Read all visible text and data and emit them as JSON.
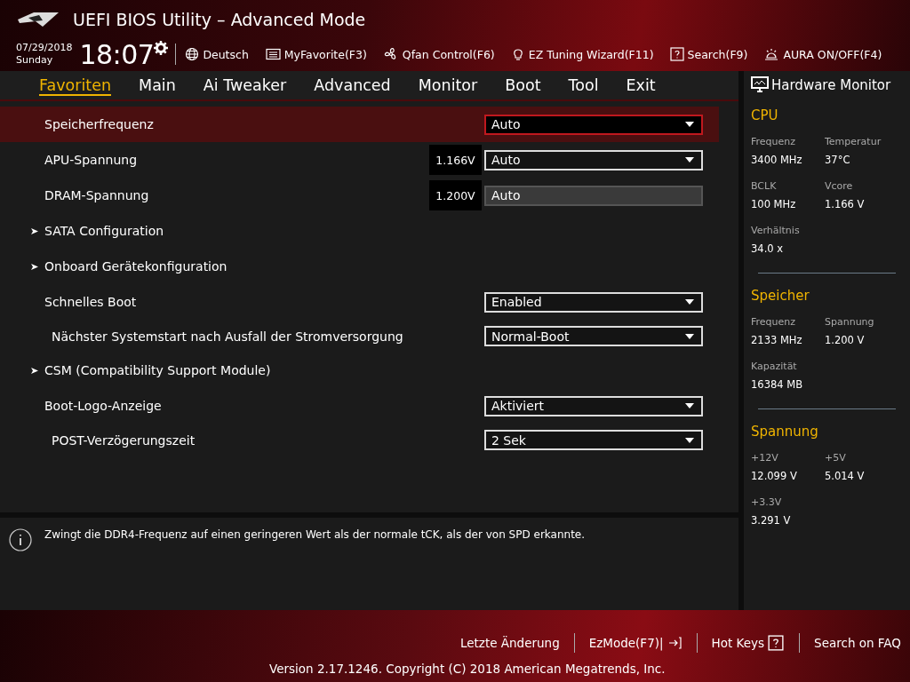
{
  "header": {
    "title": "UEFI BIOS Utility – Advanced Mode",
    "date": "07/29/2018",
    "day": "Sunday",
    "time": "18:07",
    "tools": [
      {
        "label": "Deutsch"
      },
      {
        "label": "MyFavorite(F3)"
      },
      {
        "label": "Qfan Control(F6)"
      },
      {
        "label": "EZ Tuning Wizard(F11)"
      },
      {
        "label": "Search(F9)"
      },
      {
        "label": "AURA ON/OFF(F4)"
      }
    ]
  },
  "tabs": [
    {
      "label": "Favoriten",
      "selected": true
    },
    {
      "label": "Main",
      "selected": false
    },
    {
      "label": "Ai Tweaker",
      "selected": false
    },
    {
      "label": "Advanced",
      "selected": false
    },
    {
      "label": "Monitor",
      "selected": false
    },
    {
      "label": "Boot",
      "selected": false
    },
    {
      "label": "Tool",
      "selected": false
    },
    {
      "label": "Exit",
      "selected": false
    }
  ],
  "settings": [
    {
      "kind": "dropdown",
      "label": "Speicherfrequenz",
      "value": "Auto",
      "selected": true,
      "disabled": false
    },
    {
      "kind": "dropdown",
      "label": "APU-Spannung",
      "reading": "1.166V",
      "value": "Auto",
      "selected": false,
      "disabled": false
    },
    {
      "kind": "dropdown",
      "label": "DRAM-Spannung",
      "reading": "1.200V",
      "value": "Auto",
      "selected": false,
      "disabled": true
    },
    {
      "kind": "submenu",
      "label": "SATA Configuration",
      "selected": false
    },
    {
      "kind": "submenu",
      "label": "Onboard Gerätekonfiguration",
      "selected": false
    },
    {
      "kind": "dropdown",
      "label": "Schnelles Boot",
      "value": "Enabled",
      "selected": false,
      "disabled": false,
      "children": [
        {
          "kind": "dropdown",
          "label": "Nächster Systemstart nach Ausfall der Stromversorgung",
          "value": "Normal-Boot",
          "selected": false,
          "disabled": false
        }
      ]
    },
    {
      "kind": "submenu",
      "label": "CSM (Compatibility Support Module)",
      "selected": false
    },
    {
      "kind": "dropdown",
      "label": "Boot-Logo-Anzeige",
      "value": "Aktiviert",
      "selected": false,
      "disabled": false,
      "children": [
        {
          "kind": "dropdown",
          "label": "POST-Verzögerungszeit",
          "value": "2 Sek",
          "selected": false,
          "disabled": false
        }
      ]
    }
  ],
  "help": "Zwingt die DDR4-Frequenz auf einen geringeren Wert als der normale tCK, als der von SPD erkannte.",
  "hardware_monitor": {
    "title": "Hardware Monitor",
    "sections": [
      {
        "title": "CPU",
        "items": [
          {
            "label": "Frequenz",
            "value": "3400 MHz"
          },
          {
            "label": "Temperatur",
            "value": "37°C"
          },
          {
            "label": "BCLK",
            "value": "100 MHz"
          },
          {
            "label": "Vcore",
            "value": "1.166 V"
          },
          {
            "label": "Verhältnis",
            "value": "34.0 x"
          }
        ]
      },
      {
        "title": "Speicher",
        "items": [
          {
            "label": "Frequenz",
            "value": "2133 MHz"
          },
          {
            "label": "Spannung",
            "value": "1.200 V"
          },
          {
            "label": "Kapazität",
            "value": "16384 MB"
          }
        ]
      },
      {
        "title": "Spannung",
        "items": [
          {
            "label": "+12V",
            "value": "12.099 V"
          },
          {
            "label": "+5V",
            "value": "5.014 V"
          },
          {
            "label": "+3.3V",
            "value": "3.291 V"
          }
        ]
      }
    ]
  },
  "footer": {
    "links": [
      {
        "label": "Letzte Änderung"
      },
      {
        "label": "EzMode(F7)|"
      },
      {
        "label": "Hot Keys"
      },
      {
        "label": "Search on FAQ"
      }
    ],
    "version": "Version 2.17.1246. Copyright (C) 2018 American Megatrends, Inc."
  }
}
